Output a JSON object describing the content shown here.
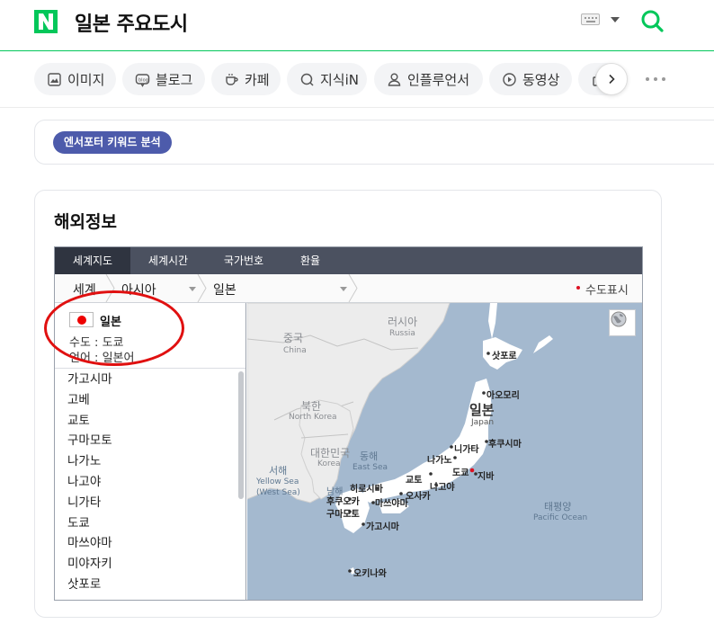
{
  "header": {
    "query": "일본 주요도시",
    "colors": {
      "brand": "#03c75a"
    },
    "icons": [
      "naver-logo-icon",
      "keyboard-icon",
      "search-icon"
    ]
  },
  "tabs": [
    {
      "label": "이미지",
      "icon": "image-icon"
    },
    {
      "label": "블로그",
      "icon": "blog-icon"
    },
    {
      "label": "카페",
      "icon": "cafe-cup-icon"
    },
    {
      "label": "지식iN",
      "icon": "kin-icon"
    },
    {
      "label": "인플루언서",
      "icon": "person-icon"
    },
    {
      "label": "동영상",
      "icon": "play-icon"
    }
  ],
  "keyword": {
    "chip": "엔서포터 키워드 분석"
  },
  "info": {
    "title": "해외정보",
    "widget_tabs": [
      "세계지도",
      "세계시간",
      "국가번호",
      "환율"
    ],
    "active_tab": "세계지도",
    "breadcrumb": [
      "세계",
      "아시아",
      "일본"
    ],
    "capital_legend": "수도표시",
    "country": {
      "name": "일본",
      "capital": "수도 : 도쿄",
      "language": "언어 : 일본어"
    },
    "cities": [
      "가고시마",
      "고베",
      "교토",
      "구마모토",
      "나가노",
      "나고야",
      "니가타",
      "도쿄",
      "마쓰야마",
      "미야자키",
      "삿포로"
    ],
    "map": {
      "russia": "러시아",
      "russia_en": "Russia",
      "china": "중국",
      "china_en": "China",
      "nk": "북한",
      "nk_en": "North Korea",
      "sk": "대한민국",
      "sk_en": "Korea",
      "east_sea": "동해",
      "east_sea_en": "East Sea",
      "yellow_sea": "서해",
      "yellow_sea_en1": "Yellow Sea",
      "yellow_sea_en2": "(West Sea)",
      "south_sea": "남해",
      "japan": "일본",
      "japan_en": "Japan",
      "pacific": "태평양",
      "pacific_en": "Pacific Ocean",
      "cities": {
        "sapporo": "삿포로",
        "aomori": "아오모리",
        "sendai": "후쿠시마",
        "niigata": "니가타",
        "nagano": "나가노",
        "tokyo": "도쿄",
        "chiba": "지바",
        "kyoto": "교토",
        "nagoya": "나고야",
        "osaka": "오사카",
        "hiroshima": "히로시마",
        "matsuyama": "마쓰야마",
        "fukuoka": "후쿠오카",
        "kumamoto": "구마모토",
        "kagoshima": "가고시마",
        "okinawa": "오키나와"
      }
    }
  }
}
